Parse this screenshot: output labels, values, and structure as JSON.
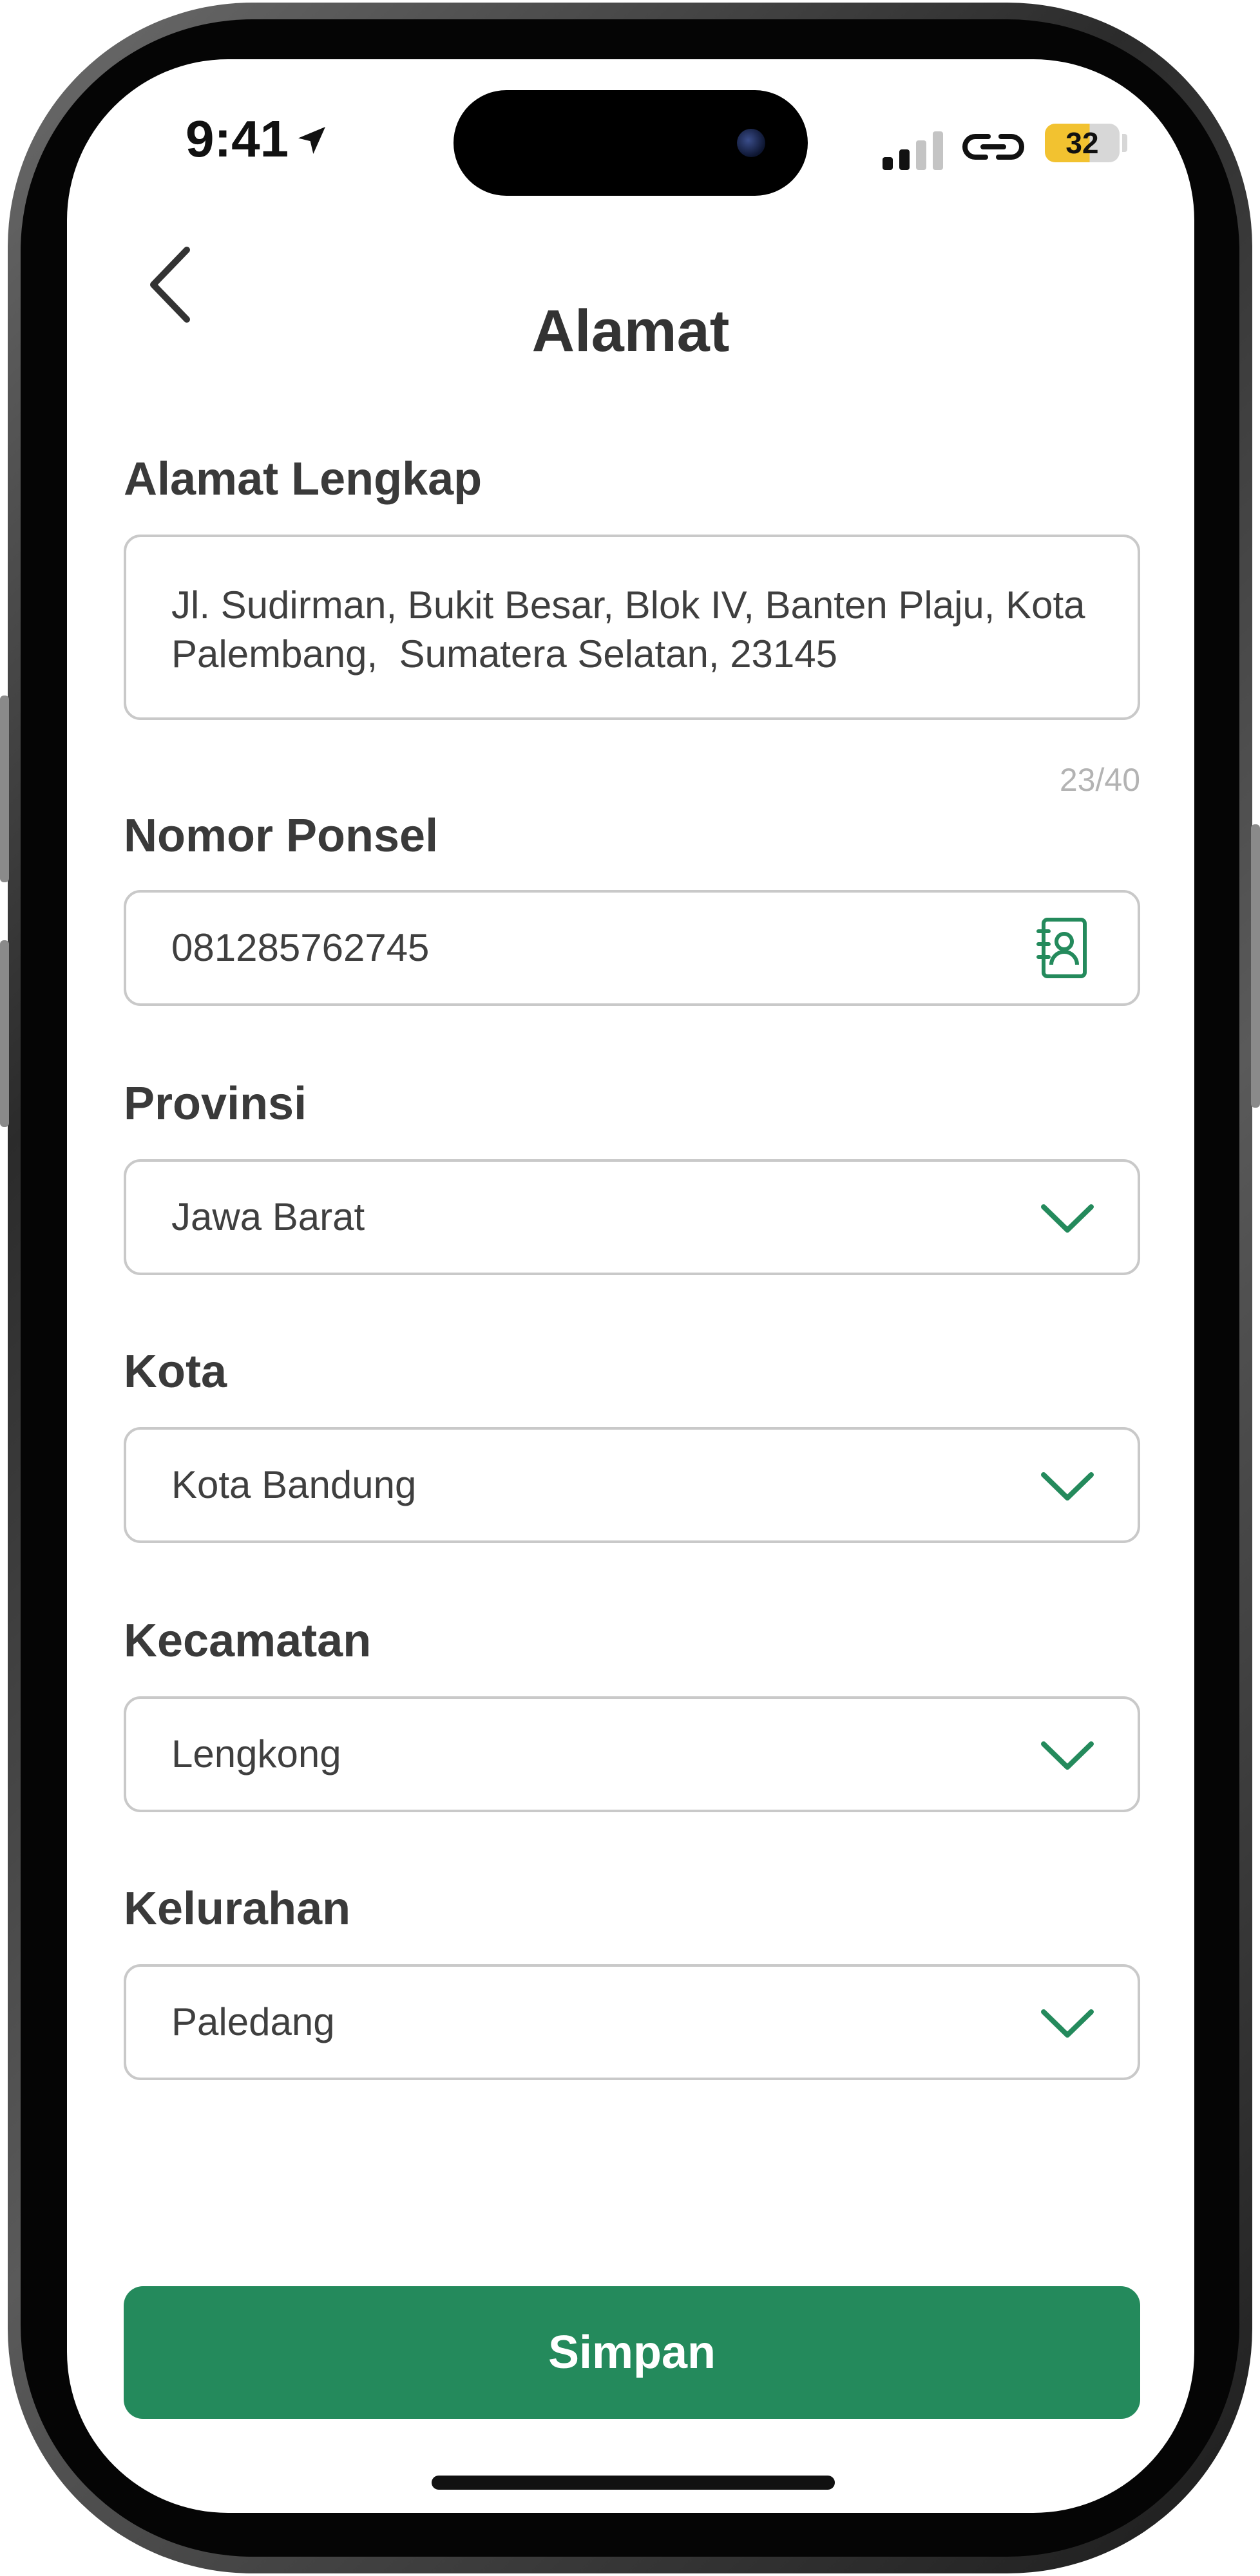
{
  "status_bar": {
    "time": "9:41",
    "battery": "32"
  },
  "header": {
    "title": "Alamat"
  },
  "form": {
    "alamat": {
      "label": "Alamat Lengkap",
      "value": "Jl. Sudirman, Bukit Besar, Blok IV, Banten Plaju, Kota\nPalembang,  Sumatera Selatan, 23145",
      "counter": "23/40"
    },
    "ponsel": {
      "label": "Nomor Ponsel",
      "value": "081285762745"
    },
    "provinsi": {
      "label": "Provinsi",
      "value": "Jawa Barat"
    },
    "kota": {
      "label": "Kota",
      "value": "Kota Bandung"
    },
    "kecamatan": {
      "label": "Kecamatan",
      "value": "Lengkong"
    },
    "kelurahan": {
      "label": "Kelurahan",
      "value": "Paledang"
    }
  },
  "actions": {
    "save_label": "Simpan"
  },
  "colors": {
    "accent": "#248a5c",
    "border": "#c9c9c9",
    "label": "#3a3a3a"
  },
  "icons": [
    "location-arrow-icon",
    "signal-icon",
    "link-icon",
    "battery-icon",
    "back-chevron-icon",
    "contact-book-icon",
    "chevron-down-icon"
  ]
}
